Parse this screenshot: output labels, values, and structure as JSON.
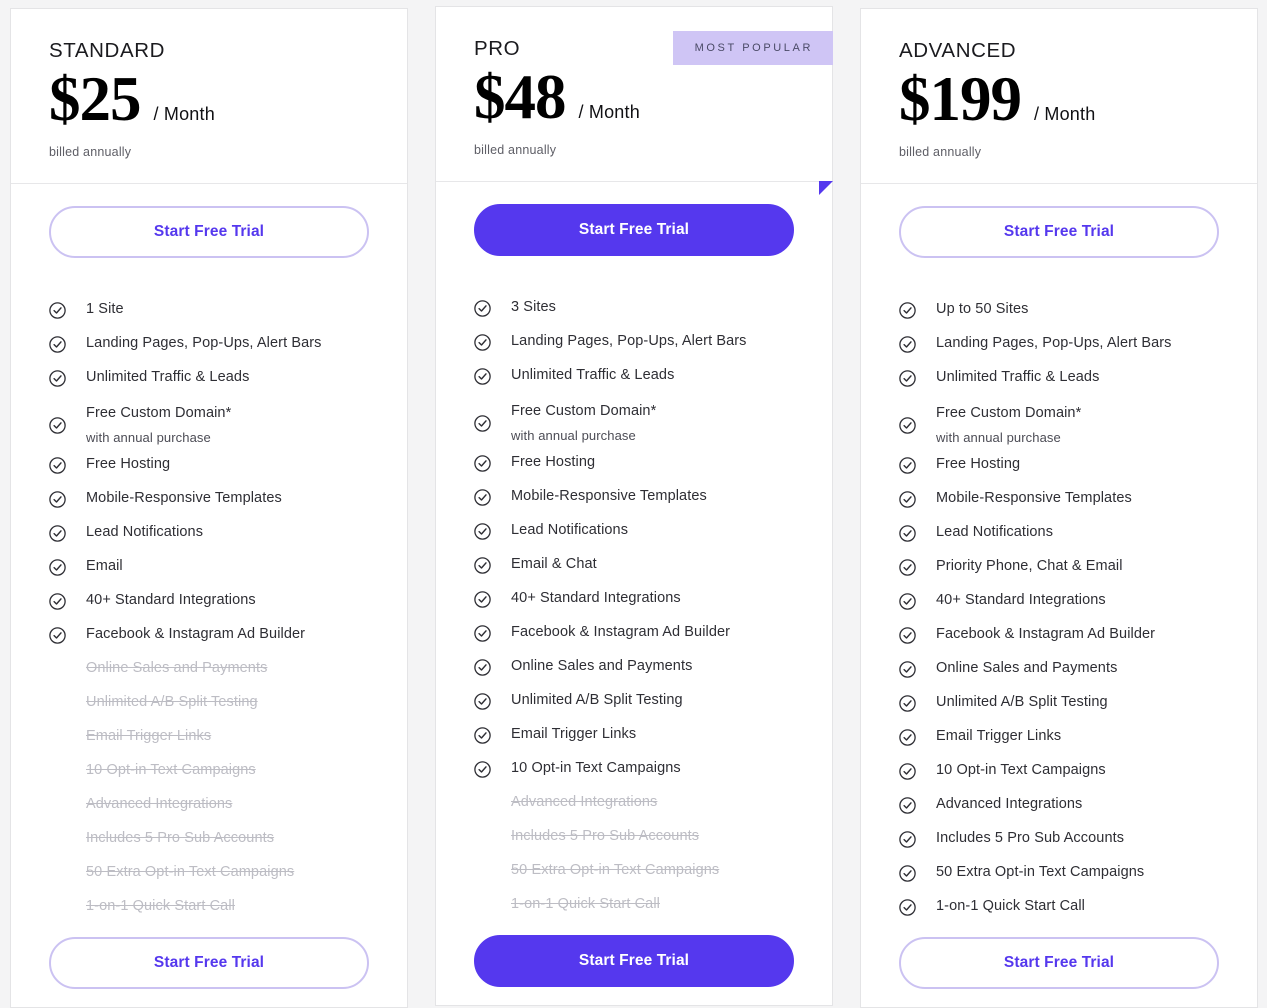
{
  "page": {
    "background_color": "#f4f4f5",
    "accent_color": "#5538ee",
    "accent_light_color": "#cbc2f2",
    "badge_bg_color": "#cfc5f5",
    "disabled_color": "#bdbdc4"
  },
  "plans": [
    {
      "name": "STANDARD",
      "price": "$25",
      "period": "/ Month",
      "billing_note": "billed annually",
      "badge": null,
      "cta_top_label": "Start Free Trial",
      "cta_bottom_label": "Start Free Trial",
      "cta_style": "outline",
      "features": [
        {
          "label": "1 Site",
          "sub": null,
          "included": true
        },
        {
          "label": "Landing Pages, Pop-Ups, Alert Bars",
          "sub": null,
          "included": true
        },
        {
          "label": "Unlimited Traffic & Leads",
          "sub": null,
          "included": true
        },
        {
          "label": "Free Custom Domain*",
          "sub": "with annual purchase",
          "included": true
        },
        {
          "label": "Free Hosting",
          "sub": null,
          "included": true
        },
        {
          "label": "Mobile-Responsive Templates",
          "sub": null,
          "included": true
        },
        {
          "label": "Lead Notifications",
          "sub": null,
          "included": true
        },
        {
          "label": "Email",
          "sub": null,
          "included": true
        },
        {
          "label": "40+ Standard Integrations",
          "sub": null,
          "included": true
        },
        {
          "label": "Facebook & Instagram Ad Builder",
          "sub": null,
          "included": true
        },
        {
          "label": "Online Sales and Payments",
          "sub": null,
          "included": false
        },
        {
          "label": "Unlimited A/B Split Testing",
          "sub": null,
          "included": false
        },
        {
          "label": "Email Trigger Links",
          "sub": null,
          "included": false
        },
        {
          "label": "10 Opt-in Text Campaigns",
          "sub": null,
          "included": false
        },
        {
          "label": "Advanced Integrations",
          "sub": null,
          "included": false
        },
        {
          "label": "Includes 5 Pro Sub Accounts",
          "sub": null,
          "included": false
        },
        {
          "label": "50 Extra Opt-in Text Campaigns",
          "sub": null,
          "included": false
        },
        {
          "label": "1-on-1 Quick Start Call",
          "sub": null,
          "included": false
        }
      ]
    },
    {
      "name": "PRO",
      "price": "$48",
      "period": "/ Month",
      "billing_note": "billed annually",
      "badge": "MOST POPULAR",
      "cta_top_label": "Start Free Trial",
      "cta_bottom_label": "Start Free Trial",
      "cta_style": "solid",
      "features": [
        {
          "label": "3 Sites",
          "sub": null,
          "included": true
        },
        {
          "label": "Landing Pages, Pop-Ups, Alert Bars",
          "sub": null,
          "included": true
        },
        {
          "label": "Unlimited Traffic & Leads",
          "sub": null,
          "included": true
        },
        {
          "label": "Free Custom Domain*",
          "sub": "with annual purchase",
          "included": true
        },
        {
          "label": "Free Hosting",
          "sub": null,
          "included": true
        },
        {
          "label": "Mobile-Responsive Templates",
          "sub": null,
          "included": true
        },
        {
          "label": "Lead Notifications",
          "sub": null,
          "included": true
        },
        {
          "label": "Email & Chat",
          "sub": null,
          "included": true
        },
        {
          "label": "40+ Standard Integrations",
          "sub": null,
          "included": true
        },
        {
          "label": "Facebook & Instagram Ad Builder",
          "sub": null,
          "included": true
        },
        {
          "label": "Online Sales and Payments",
          "sub": null,
          "included": true
        },
        {
          "label": "Unlimited A/B Split Testing",
          "sub": null,
          "included": true
        },
        {
          "label": "Email Trigger Links",
          "sub": null,
          "included": true
        },
        {
          "label": "10 Opt-in Text Campaigns",
          "sub": null,
          "included": true
        },
        {
          "label": "Advanced Integrations",
          "sub": null,
          "included": false
        },
        {
          "label": "Includes 5 Pro Sub Accounts",
          "sub": null,
          "included": false
        },
        {
          "label": "50 Extra Opt-in Text Campaigns",
          "sub": null,
          "included": false
        },
        {
          "label": "1-on-1 Quick Start Call",
          "sub": null,
          "included": false
        }
      ]
    },
    {
      "name": "ADVANCED",
      "price": "$199",
      "period": "/ Month",
      "billing_note": "billed annually",
      "badge": null,
      "cta_top_label": "Start Free Trial",
      "cta_bottom_label": "Start Free Trial",
      "cta_style": "outline",
      "features": [
        {
          "label": "Up to 50 Sites",
          "sub": null,
          "included": true
        },
        {
          "label": "Landing Pages, Pop-Ups, Alert Bars",
          "sub": null,
          "included": true
        },
        {
          "label": "Unlimited Traffic & Leads",
          "sub": null,
          "included": true
        },
        {
          "label": "Free Custom Domain*",
          "sub": "with annual purchase",
          "included": true
        },
        {
          "label": "Free Hosting",
          "sub": null,
          "included": true
        },
        {
          "label": "Mobile-Responsive Templates",
          "sub": null,
          "included": true
        },
        {
          "label": "Lead Notifications",
          "sub": null,
          "included": true
        },
        {
          "label": "Priority Phone, Chat & Email",
          "sub": null,
          "included": true
        },
        {
          "label": "40+ Standard Integrations",
          "sub": null,
          "included": true
        },
        {
          "label": "Facebook & Instagram Ad Builder",
          "sub": null,
          "included": true
        },
        {
          "label": "Online Sales and Payments",
          "sub": null,
          "included": true
        },
        {
          "label": "Unlimited A/B Split Testing",
          "sub": null,
          "included": true
        },
        {
          "label": "Email Trigger Links",
          "sub": null,
          "included": true
        },
        {
          "label": "10 Opt-in Text Campaigns",
          "sub": null,
          "included": true
        },
        {
          "label": "Advanced Integrations",
          "sub": null,
          "included": true
        },
        {
          "label": "Includes 5 Pro Sub Accounts",
          "sub": null,
          "included": true
        },
        {
          "label": "50 Extra Opt-in Text Campaigns",
          "sub": null,
          "included": true
        },
        {
          "label": "1-on-1 Quick Start Call",
          "sub": null,
          "included": true
        }
      ]
    }
  ],
  "icons": {
    "check_circle": "check-circle-icon"
  }
}
